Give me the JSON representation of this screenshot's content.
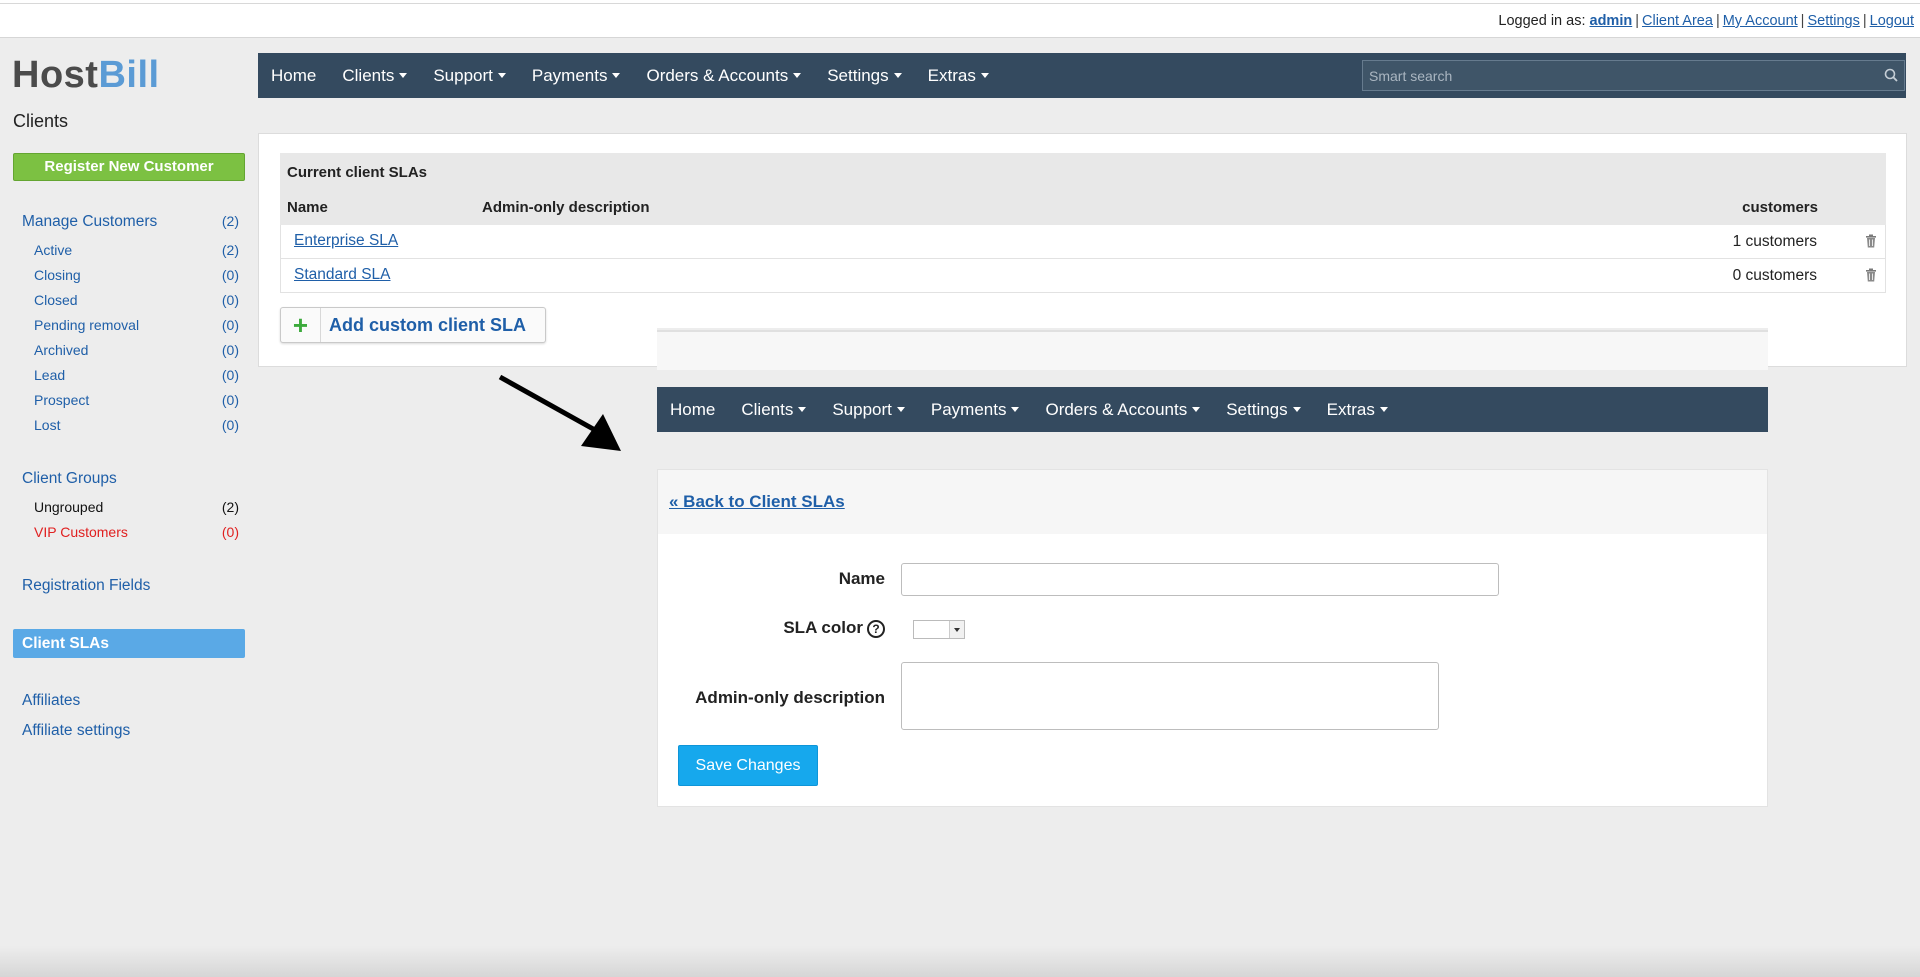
{
  "topbar": {
    "logged_in_label": "Logged in as:",
    "user": "admin",
    "links": [
      "Client Area",
      "My Account",
      "Settings",
      "Logout"
    ]
  },
  "logo": {
    "part1": "Host",
    "part2": "Bill"
  },
  "sidebar": {
    "title": "Clients",
    "register_button": "Register New Customer",
    "manage": {
      "label": "Manage Customers",
      "count": "(2)"
    },
    "statuses": [
      {
        "label": "Active",
        "count": "(2)"
      },
      {
        "label": "Closing",
        "count": "(0)"
      },
      {
        "label": "Closed",
        "count": "(0)"
      },
      {
        "label": "Pending removal",
        "count": "(0)"
      },
      {
        "label": "Archived",
        "count": "(0)"
      },
      {
        "label": "Lead",
        "count": "(0)"
      },
      {
        "label": "Prospect",
        "count": "(0)"
      },
      {
        "label": "Lost",
        "count": "(0)"
      }
    ],
    "groups_label": "Client Groups",
    "groups": [
      {
        "label": "Ungrouped",
        "count": "(2)"
      },
      {
        "label": "VIP Customers",
        "count": "(0)"
      }
    ],
    "registration_fields": "Registration Fields",
    "client_slas": "Client SLAs",
    "affiliates": "Affiliates",
    "affiliate_settings": "Affiliate settings"
  },
  "nav": {
    "items": [
      "Home",
      "Clients",
      "Support",
      "Payments",
      "Orders & Accounts",
      "Settings",
      "Extras"
    ],
    "search_placeholder": "Smart search"
  },
  "sla_list": {
    "caption": "Current client SLAs",
    "columns": {
      "name": "Name",
      "description": "Admin-only description",
      "customers": "customers"
    },
    "rows": [
      {
        "name": "Enterprise SLA",
        "customers": "1 customers"
      },
      {
        "name": "Standard SLA",
        "customers": "0 customers"
      }
    ],
    "add_button": "Add custom client SLA"
  },
  "form": {
    "back_link": "« Back to Client SLAs",
    "name_label": "Name",
    "name_value": "",
    "color_label": "SLA color",
    "help_glyph": "?",
    "description_label": "Admin-only description",
    "description_value": "",
    "save_button": "Save Changes"
  },
  "colors": {
    "nav_bg": "#344a5f",
    "accent_green": "#7cc142",
    "active_item": "#5aa9e6",
    "save_blue": "#16a8ed",
    "link": "#1f5fa8",
    "red": "#e02020"
  }
}
